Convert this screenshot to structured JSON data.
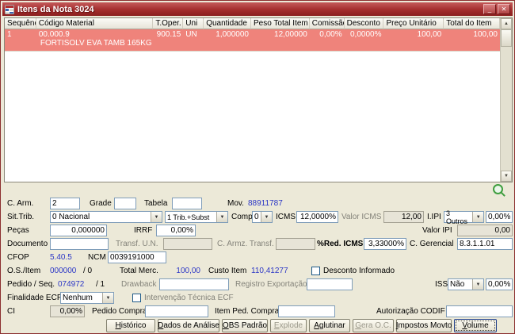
{
  "colors": {
    "titlebar_red": "#a42d2d",
    "row_highlight": "#ef837b",
    "value_blue": "#2b36c6",
    "readonly_bg": "#e7e4d7"
  },
  "window": {
    "title": "Itens da Nota 3024"
  },
  "titlebar_icons": {
    "minimize": "_",
    "close": "✕"
  },
  "grid": {
    "columns": [
      "Sequência",
      "Código Material",
      "T.Oper.",
      "Uni",
      "Quantidade",
      "Peso Total Item",
      "Comissão",
      "Desconto",
      "Preço Unitário",
      "Total do Item"
    ],
    "row": {
      "sequencia": "1",
      "codigo": "00.000.9",
      "descricao": "FORTISOLV EVA TAMB 165KG",
      "t_oper": "900.15",
      "uni": "UN",
      "quantidade": "1,000000",
      "peso_total": "12,00000",
      "comissao": "0,00%",
      "desconto": "0,0000%",
      "preco_unitario": "100,00",
      "total_item": "100,00"
    }
  },
  "form": {
    "c_arm": {
      "label": "C. Arm.",
      "value": "2"
    },
    "grade": {
      "label": "Grade",
      "value": ""
    },
    "tabela": {
      "label": "Tabela",
      "value": ""
    },
    "mov": {
      "label": "Mov.",
      "value": "88911787"
    },
    "sit_trib": {
      "label": "Sit.Trib.",
      "value": "0 Nacional"
    },
    "trib_subst": {
      "value": "1 Trib.+Subst"
    },
    "compl": {
      "label": "Compl",
      "value": "0"
    },
    "icms": {
      "label": "ICMS",
      "value": "12,0000%"
    },
    "valor_icms": {
      "label": "Valor ICMS",
      "value": "12,00"
    },
    "ipi": {
      "label": "I.IPI",
      "value": "3 Outros",
      "pct": "0,00%"
    },
    "pecas": {
      "label": "Peças",
      "value": "0,000000"
    },
    "irrf": {
      "label": "IRRF",
      "value": "0,00%"
    },
    "valor_ipi": {
      "label": "Valor IPI",
      "value": "0,00"
    },
    "documento": {
      "label": "Documento",
      "value": ""
    },
    "transf_un": {
      "label": "Transf. U.N.",
      "value": ""
    },
    "c_armz_transf": {
      "label": "C. Armz. Transf.",
      "value": ""
    },
    "red_icms": {
      "label": "%Red. ICMS",
      "value": "3,33000%"
    },
    "c_gerencial": {
      "label": "C. Gerencial",
      "value": "8.3.1.1.01"
    },
    "cfop": {
      "label": "CFOP",
      "value": "5.40.5"
    },
    "ncm": {
      "label": "NCM",
      "value": "0039191000"
    },
    "os_item": {
      "label": "O.S./Item",
      "value": "000000",
      "seq": "/ 0"
    },
    "total_merc": {
      "label": "Total Merc.",
      "value": "100,00"
    },
    "custo_item": {
      "label": "Custo Item",
      "value": "110,41277"
    },
    "desconto_informado": {
      "label": "Desconto Informado",
      "checked": false
    },
    "pedido_seq": {
      "label": "Pedido / Seq.",
      "value": "074972",
      "seq": "/ 1"
    },
    "drawback": {
      "label": "Drawback",
      "value": ""
    },
    "registro_exportacao": {
      "label": "Registro Exportação",
      "value": ""
    },
    "iss": {
      "label": "ISS",
      "value": "Não",
      "pct": "0,00%"
    },
    "finalidade_ecf": {
      "label": "Finalidade ECF",
      "value": "Nenhum"
    },
    "intervencao_ecf": {
      "label": "Intervenção Técnica ECF",
      "checked": false
    },
    "ci": {
      "label": "CI",
      "value": "0,00%"
    },
    "pedido_compra": {
      "label": "Pedido Compra",
      "value": ""
    },
    "item_ped_compra": {
      "label": "Item Ped. Compra",
      "value": ""
    },
    "autorizacao_codif": {
      "label": "Autorização CODIF",
      "value": ""
    }
  },
  "buttons": [
    {
      "label": "Histórico",
      "enabled": true
    },
    {
      "label": "Dados de Análise",
      "enabled": true
    },
    {
      "label": "OBS Padrão",
      "enabled": true
    },
    {
      "label": "Explode",
      "enabled": false
    },
    {
      "label": "Aglutinar",
      "enabled": true
    },
    {
      "label": "Gera O.C.",
      "enabled": false
    },
    {
      "label": "Impostos Movto",
      "enabled": true
    },
    {
      "label": "Volume",
      "enabled": true,
      "focused": true
    }
  ]
}
